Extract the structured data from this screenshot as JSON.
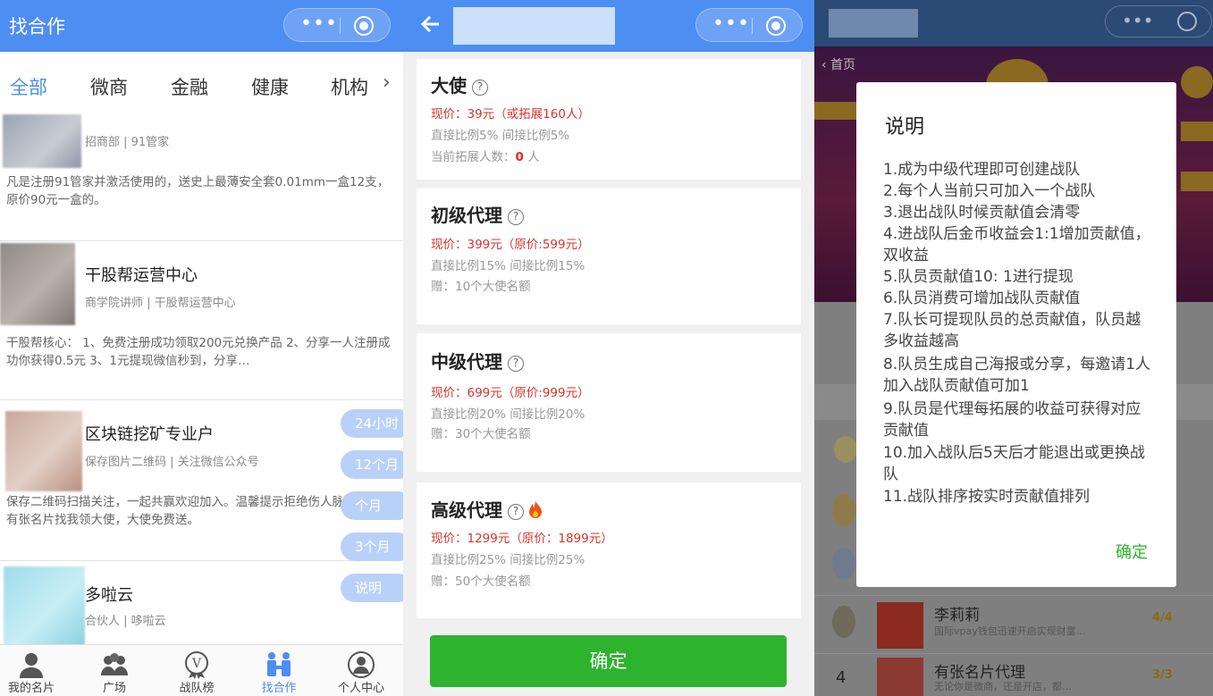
{
  "panel1": {
    "title": "找合作",
    "tabs": [
      "全部",
      "微商",
      "金融",
      "健康",
      "机构"
    ],
    "tab_more": "›",
    "cards": [
      {
        "title": "",
        "sub": "招商部 | 91管家",
        "desc": "凡是注册91管家并激活使用的，送史上最薄安全套0.01mm一盒12支，原价90元一盒的。"
      },
      {
        "title": "干股帮运营中心",
        "sub": "商学院讲师 | 干股帮运营中心",
        "desc": "干股帮核心： 1、免费注册成功领取200元兑换产品 2、分享一人注册成功你获得0.5元 3、1元提现微信秒到，分享…"
      },
      {
        "title": "区块链挖矿专业户",
        "sub": "保存图片二维码 | 关注微信公众号",
        "desc": "保存二维码扫描关注，一起共赢欢迎加入。温馨提示拒绝伤人脉项目。有张名片找我领大使，大使免费送。"
      },
      {
        "title": "多啦云",
        "sub": "合伙人 | 哆啦云",
        "desc": ""
      }
    ],
    "pills": [
      "24小时",
      "12个月",
      "个月",
      "3个月",
      "说明"
    ],
    "tabbar": [
      "我的名片",
      "广场",
      "战队榜",
      "找合作",
      "个人中心"
    ]
  },
  "panel2": {
    "tiers": [
      {
        "name": "大使",
        "price": "现价：39元（或拓展160人）",
        "ratio": "直接比例5% 间接比例5%",
        "extra_prefix": "当前拓展人数：",
        "extra_value": "0",
        "extra_suffix": " 人"
      },
      {
        "name": "初级代理",
        "price": "现价：399元（原价:599元）",
        "ratio": "直接比例15% 间接比例15%",
        "extra": "赠：10个大使名额"
      },
      {
        "name": "中级代理",
        "price": "现价：699元（原价:999元）",
        "ratio": "直接比例20% 间接比例20%",
        "extra": "赠：30个大使名额"
      },
      {
        "name": "高级代理",
        "price": "现价：1299元（原价：1899元）",
        "ratio": "直接比例25% 间接比例25%",
        "extra": "赠：50个大使名额"
      }
    ],
    "confirm": "确定"
  },
  "panel3": {
    "back": "‹ 首页",
    "bg_rows": [
      {
        "rank": "",
        "name": "李莉莉",
        "desc": "国际vpay钱包迅速开启实现财富…",
        "score": "4/4"
      },
      {
        "rank": "4",
        "name": "有张名片代理",
        "desc": "无论你是微商，还是开店，都…",
        "score": "3/3"
      }
    ],
    "modal": {
      "title": "说明",
      "lines": [
        "1.成为中级代理即可创建战队",
        "2.每个人当前只可加入一个战队",
        "3.退出战队时候贡献值会清零",
        "4.进战队后金币收益会1:1增加贡献值，双收益",
        "5.队员贡献值10: 1进行提现",
        "6.队员消费可增加战队贡献值",
        "7.队长可提现队员的总贡献值，队员越多收益越高",
        "8.队员生成自己海报或分享，每邀请1人加入战队贡献值可加1",
        "9.队员是代理每拓展的收益可获得对应贡献值",
        "10.加入战队后5天后才能退出或更换战队",
        "11.战队排序按实时贡献值排列"
      ],
      "ok": "确定"
    }
  }
}
